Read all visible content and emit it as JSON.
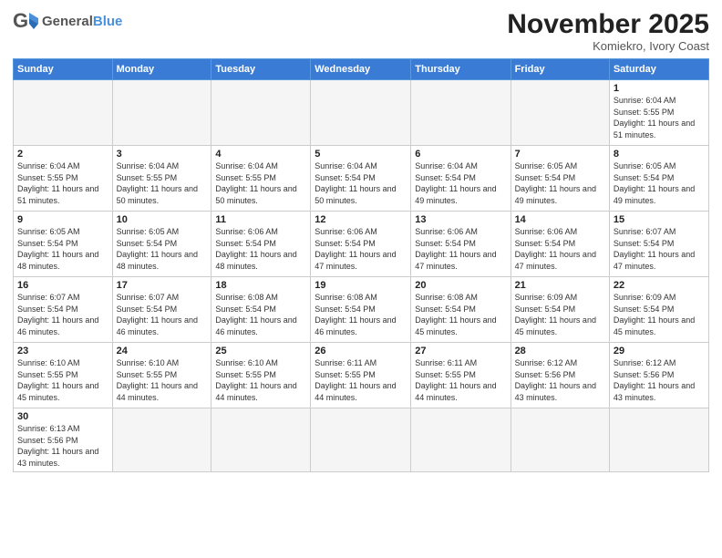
{
  "logo": {
    "text_general": "General",
    "text_blue": "Blue"
  },
  "header": {
    "month": "November 2025",
    "location": "Komiekro, Ivory Coast"
  },
  "days_of_week": [
    "Sunday",
    "Monday",
    "Tuesday",
    "Wednesday",
    "Thursday",
    "Friday",
    "Saturday"
  ],
  "weeks": [
    [
      null,
      null,
      null,
      null,
      null,
      null,
      {
        "day": "1",
        "sunrise": "Sunrise: 6:04 AM",
        "sunset": "Sunset: 5:55 PM",
        "daylight": "Daylight: 11 hours and 51 minutes."
      }
    ],
    [
      {
        "day": "2",
        "sunrise": "Sunrise: 6:04 AM",
        "sunset": "Sunset: 5:55 PM",
        "daylight": "Daylight: 11 hours and 51 minutes."
      },
      {
        "day": "3",
        "sunrise": "Sunrise: 6:04 AM",
        "sunset": "Sunset: 5:55 PM",
        "daylight": "Daylight: 11 hours and 50 minutes."
      },
      {
        "day": "4",
        "sunrise": "Sunrise: 6:04 AM",
        "sunset": "Sunset: 5:55 PM",
        "daylight": "Daylight: 11 hours and 50 minutes."
      },
      {
        "day": "5",
        "sunrise": "Sunrise: 6:04 AM",
        "sunset": "Sunset: 5:54 PM",
        "daylight": "Daylight: 11 hours and 50 minutes."
      },
      {
        "day": "6",
        "sunrise": "Sunrise: 6:04 AM",
        "sunset": "Sunset: 5:54 PM",
        "daylight": "Daylight: 11 hours and 49 minutes."
      },
      {
        "day": "7",
        "sunrise": "Sunrise: 6:05 AM",
        "sunset": "Sunset: 5:54 PM",
        "daylight": "Daylight: 11 hours and 49 minutes."
      },
      {
        "day": "8",
        "sunrise": "Sunrise: 6:05 AM",
        "sunset": "Sunset: 5:54 PM",
        "daylight": "Daylight: 11 hours and 49 minutes."
      }
    ],
    [
      {
        "day": "9",
        "sunrise": "Sunrise: 6:05 AM",
        "sunset": "Sunset: 5:54 PM",
        "daylight": "Daylight: 11 hours and 48 minutes."
      },
      {
        "day": "10",
        "sunrise": "Sunrise: 6:05 AM",
        "sunset": "Sunset: 5:54 PM",
        "daylight": "Daylight: 11 hours and 48 minutes."
      },
      {
        "day": "11",
        "sunrise": "Sunrise: 6:06 AM",
        "sunset": "Sunset: 5:54 PM",
        "daylight": "Daylight: 11 hours and 48 minutes."
      },
      {
        "day": "12",
        "sunrise": "Sunrise: 6:06 AM",
        "sunset": "Sunset: 5:54 PM",
        "daylight": "Daylight: 11 hours and 47 minutes."
      },
      {
        "day": "13",
        "sunrise": "Sunrise: 6:06 AM",
        "sunset": "Sunset: 5:54 PM",
        "daylight": "Daylight: 11 hours and 47 minutes."
      },
      {
        "day": "14",
        "sunrise": "Sunrise: 6:06 AM",
        "sunset": "Sunset: 5:54 PM",
        "daylight": "Daylight: 11 hours and 47 minutes."
      },
      {
        "day": "15",
        "sunrise": "Sunrise: 6:07 AM",
        "sunset": "Sunset: 5:54 PM",
        "daylight": "Daylight: 11 hours and 47 minutes."
      }
    ],
    [
      {
        "day": "16",
        "sunrise": "Sunrise: 6:07 AM",
        "sunset": "Sunset: 5:54 PM",
        "daylight": "Daylight: 11 hours and 46 minutes."
      },
      {
        "day": "17",
        "sunrise": "Sunrise: 6:07 AM",
        "sunset": "Sunset: 5:54 PM",
        "daylight": "Daylight: 11 hours and 46 minutes."
      },
      {
        "day": "18",
        "sunrise": "Sunrise: 6:08 AM",
        "sunset": "Sunset: 5:54 PM",
        "daylight": "Daylight: 11 hours and 46 minutes."
      },
      {
        "day": "19",
        "sunrise": "Sunrise: 6:08 AM",
        "sunset": "Sunset: 5:54 PM",
        "daylight": "Daylight: 11 hours and 46 minutes."
      },
      {
        "day": "20",
        "sunrise": "Sunrise: 6:08 AM",
        "sunset": "Sunset: 5:54 PM",
        "daylight": "Daylight: 11 hours and 45 minutes."
      },
      {
        "day": "21",
        "sunrise": "Sunrise: 6:09 AM",
        "sunset": "Sunset: 5:54 PM",
        "daylight": "Daylight: 11 hours and 45 minutes."
      },
      {
        "day": "22",
        "sunrise": "Sunrise: 6:09 AM",
        "sunset": "Sunset: 5:54 PM",
        "daylight": "Daylight: 11 hours and 45 minutes."
      }
    ],
    [
      {
        "day": "23",
        "sunrise": "Sunrise: 6:10 AM",
        "sunset": "Sunset: 5:55 PM",
        "daylight": "Daylight: 11 hours and 45 minutes."
      },
      {
        "day": "24",
        "sunrise": "Sunrise: 6:10 AM",
        "sunset": "Sunset: 5:55 PM",
        "daylight": "Daylight: 11 hours and 44 minutes."
      },
      {
        "day": "25",
        "sunrise": "Sunrise: 6:10 AM",
        "sunset": "Sunset: 5:55 PM",
        "daylight": "Daylight: 11 hours and 44 minutes."
      },
      {
        "day": "26",
        "sunrise": "Sunrise: 6:11 AM",
        "sunset": "Sunset: 5:55 PM",
        "daylight": "Daylight: 11 hours and 44 minutes."
      },
      {
        "day": "27",
        "sunrise": "Sunrise: 6:11 AM",
        "sunset": "Sunset: 5:55 PM",
        "daylight": "Daylight: 11 hours and 44 minutes."
      },
      {
        "day": "28",
        "sunrise": "Sunrise: 6:12 AM",
        "sunset": "Sunset: 5:56 PM",
        "daylight": "Daylight: 11 hours and 43 minutes."
      },
      {
        "day": "29",
        "sunrise": "Sunrise: 6:12 AM",
        "sunset": "Sunset: 5:56 PM",
        "daylight": "Daylight: 11 hours and 43 minutes."
      }
    ],
    [
      {
        "day": "30",
        "sunrise": "Sunrise: 6:13 AM",
        "sunset": "Sunset: 5:56 PM",
        "daylight": "Daylight: 11 hours and 43 minutes."
      },
      null,
      null,
      null,
      null,
      null,
      null
    ]
  ]
}
